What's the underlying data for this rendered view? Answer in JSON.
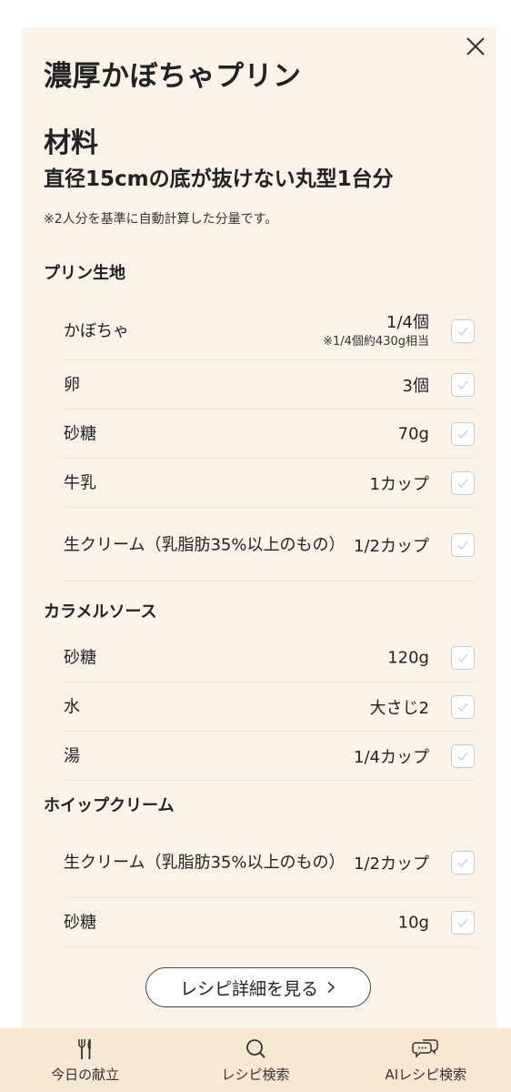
{
  "recipe": {
    "title": "濃厚かぼちゃプリン"
  },
  "ingredients": {
    "heading": "材料",
    "yield": "直径15cmの底が抜けない丸型1台分",
    "note": "※2人分を基準に自動計算した分量です。",
    "groups": [
      {
        "title": "プリン生地",
        "items": [
          {
            "name": "かぼちゃ",
            "amount": "1/4個",
            "sub": "※1/4個約430g相当"
          },
          {
            "name": "卵",
            "amount": "3個"
          },
          {
            "name": "砂糖",
            "amount": "70g"
          },
          {
            "name": "牛乳",
            "amount": "1カップ"
          },
          {
            "name": "生クリーム（乳脂肪35%以上のもの）",
            "amount": "1/2カップ"
          }
        ]
      },
      {
        "title": "カラメルソース",
        "items": [
          {
            "name": "砂糖",
            "amount": "120g"
          },
          {
            "name": "水",
            "amount": "大さじ2"
          },
          {
            "name": "湯",
            "amount": "1/4カップ"
          }
        ]
      },
      {
        "title": "ホイップクリーム",
        "items": [
          {
            "name": "生クリーム（乳脂肪35%以上のもの）",
            "amount": "1/2カップ"
          },
          {
            "name": "砂糖",
            "amount": "10g"
          }
        ]
      }
    ]
  },
  "detail_button": {
    "label": "レシピ詳細を見る"
  },
  "nav": {
    "items": [
      {
        "label": "今日の献立",
        "icon": "fork-knife-icon"
      },
      {
        "label": "レシピ検索",
        "icon": "search-icon"
      },
      {
        "label": "AIレシピ検索",
        "icon": "chat-bubbles-icon"
      }
    ]
  },
  "colors": {
    "sheet_bg": "#fbf3e8",
    "nav_bg": "#f7e7d3"
  }
}
